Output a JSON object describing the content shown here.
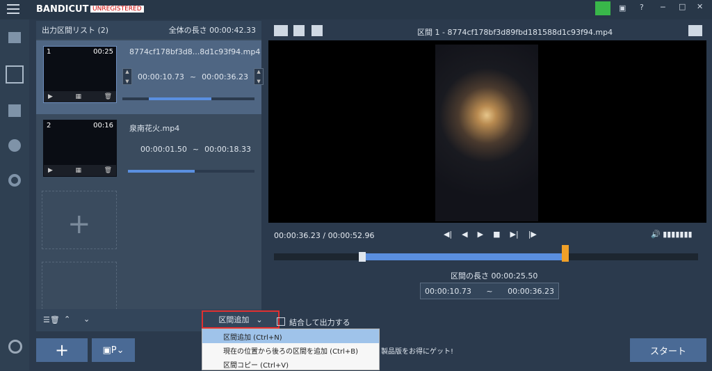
{
  "app": {
    "name": "BANDICUT",
    "status": "UNREGISTERED"
  },
  "window": {
    "min": "─",
    "max": "□",
    "close": "✕"
  },
  "sidebar": {
    "items": [
      "home-icon",
      "cut-icon",
      "film-icon",
      "info-icon",
      "gear-icon"
    ],
    "bottom": "record-icon"
  },
  "list": {
    "title": "出力区間リスト (2)",
    "total": "全体の長さ 00:00:42.33"
  },
  "clips": [
    {
      "no": "1",
      "duration": "00:25",
      "name": "8774cf178bf3d8...8d1c93f94.mp4",
      "start": "00:00:10.73",
      "end": "00:00:36.23",
      "progress": 0.45
    },
    {
      "no": "2",
      "duration": "00:16",
      "name": "泉南花火.mp4",
      "start": "00:00:01.50",
      "end": "00:00:18.33",
      "progress": 0.5
    }
  ],
  "listbar": {
    "add_range": "区間追加",
    "merge": "結合して出力する"
  },
  "menu": [
    "区間追加 (Ctrl+N)",
    "現在の位置から後ろの区間を追加 (Ctrl+B)",
    "区間コピー (Ctrl+V)"
  ],
  "video": {
    "title": "区間 1 - 8774cf178bf3d89fbd181588d1c93f94.mp4",
    "time": "00:00:36.23 / 00:00:52.96",
    "section_len": "区間の長さ 00:00:25.50",
    "start": "00:00:10.73",
    "end": "00:00:36.23",
    "tilde": "~"
  },
  "bottom": {
    "start": "スタート",
    "promo": "製品版をお得にゲット!"
  }
}
